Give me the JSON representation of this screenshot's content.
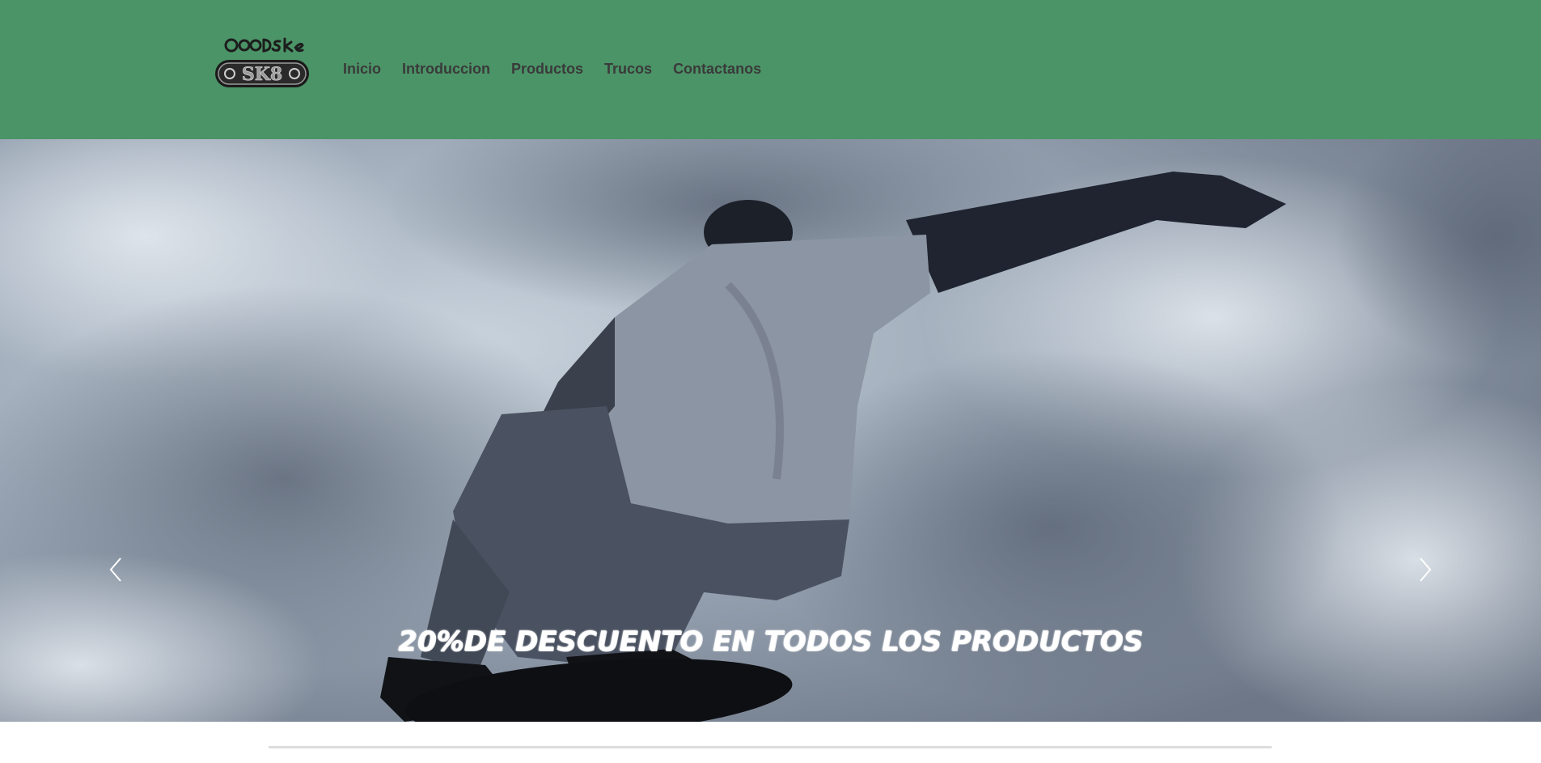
{
  "brand": {
    "logo_top_text": "GOOD SK8",
    "logo_board_text": "SK8",
    "nav_bg": "#4b9467"
  },
  "nav": {
    "items": [
      {
        "label": "Inicio"
      },
      {
        "label": "Introduccion"
      },
      {
        "label": "Productos"
      },
      {
        "label": "Trucos"
      },
      {
        "label": "Contactanos"
      }
    ]
  },
  "carousel": {
    "caption": "20%DE DESCUENTO EN TODOS LOS PRODUCTOS",
    "prev_icon": "chevron-left-icon",
    "next_icon": "chevron-right-icon",
    "image": "skateboarder-jumping-against-cloudy-sky"
  }
}
